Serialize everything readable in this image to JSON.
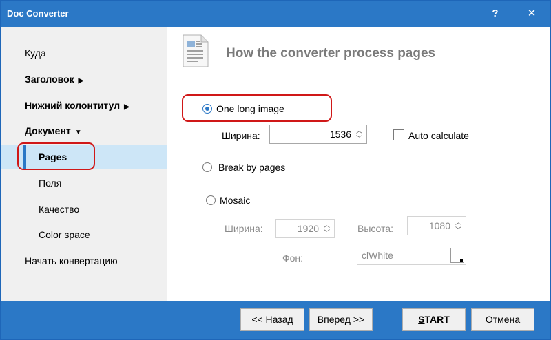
{
  "window": {
    "title": "Doc Converter",
    "help_label": "?",
    "close_label": "✕",
    "accent_color": "#2b78c6",
    "highlight_color": "#d01818"
  },
  "sidebar": {
    "items": [
      {
        "label": "Куда",
        "bold": false
      },
      {
        "label": "Заголовок",
        "bold": true,
        "arrow": "▶"
      },
      {
        "label": "Нижний колонтитул",
        "bold": true,
        "arrow": "▶"
      },
      {
        "label": "Документ",
        "bold": true,
        "arrow": "▼"
      },
      {
        "label": "Pages",
        "bold": true,
        "selected": true
      },
      {
        "label": "Поля"
      },
      {
        "label": "Качество"
      },
      {
        "label": "Color space"
      },
      {
        "label": "Начать конвертацию"
      }
    ]
  },
  "content": {
    "heading": "How the converter process pages",
    "heading_icon": "document-icon",
    "one_long_image": {
      "label": "One long image",
      "checked": true,
      "width_label": "Ширина:",
      "width_value": "1536",
      "auto_calculate_label": "Auto calculate"
    },
    "break_by_pages": {
      "label": "Break by pages",
      "checked": false
    },
    "mosaic": {
      "label": "Mosaic",
      "checked": false,
      "width_label": "Ширина:",
      "width_value": "1920",
      "height_label": "Высота:",
      "height_value": "1080",
      "background_label": "Фон:",
      "background_value": "clWhite"
    }
  },
  "footer": {
    "back_label": "<< Назад",
    "next_label": "Вперед >>",
    "start_first": "S",
    "start_rest": "TART",
    "cancel_label": "Отмена"
  }
}
